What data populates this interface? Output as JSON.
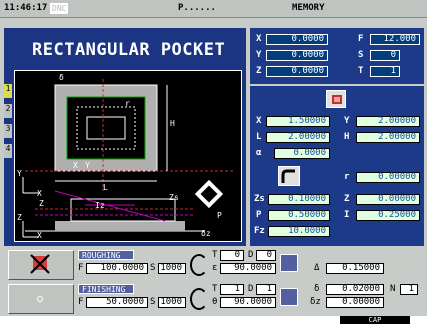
{
  "status": {
    "time": "11:46:17",
    "mode_badge": "DNC",
    "program": "P......",
    "memory": "MEMORY"
  },
  "title": "RECTANGULAR POCKET",
  "side_tabs": [
    "1",
    "2",
    "3",
    "4"
  ],
  "top_params": [
    {
      "label": "X",
      "value": "0.0000"
    },
    {
      "label": "F",
      "value": "12.000"
    },
    {
      "label": "Y",
      "value": "0.0000"
    },
    {
      "label": "S",
      "value": "0"
    },
    {
      "label": "Z",
      "value": "0.0000"
    },
    {
      "label": "T",
      "value": "1"
    }
  ],
  "geom_params": {
    "x_label": "X",
    "x_value": "1.50000",
    "y_label": "Y",
    "y_value": "2.00000",
    "l_label": "L",
    "l_value": "2.00000",
    "h_label": "H",
    "h_value": "2.00000",
    "a_label": "α",
    "a_value": "0.0000",
    "r_label": "r",
    "r_value": "0.00000",
    "zs_label": "Zs",
    "zs_value": "0.10000",
    "z_label": "Z",
    "z_value": "0.00000",
    "p_label": "P",
    "p_value": "0.50000",
    "i_label": "I",
    "i_value": "0.25000",
    "fz_label": "Fz",
    "fz_value": "10.0000"
  },
  "drawing_labels": {
    "d_top": "δ",
    "r": "r",
    "h": "H",
    "l": "L",
    "x": "X",
    "y": "Y",
    "zs": "Zs",
    "z": "Z",
    "iz": "Iz",
    "p": "P",
    "dz": "δz",
    "axis_y": "Y",
    "axis_x": "X",
    "axis_z": "Z",
    "axis_x2": "X"
  },
  "roughing": {
    "tag": "ROUGHING",
    "f_label": "F",
    "f_value": "100.0000",
    "s_label": "S",
    "s_value": "1000",
    "t_label": "T",
    "t_value": "0",
    "d_label": "D",
    "d_value": "0",
    "e_label": "ε",
    "e_value": "90.0000",
    "delta_label": "Δ",
    "delta_value": "0.15000"
  },
  "finishing": {
    "tag": "FINISHING",
    "f_label": "F",
    "f_value": "50.0000",
    "s_label": "S",
    "s_value": "1000",
    "t_label": "T",
    "t_value": "1",
    "d_label": "D",
    "d_value": "1",
    "theta_label": "θ",
    "theta_value": "90.0000",
    "delta_label": "δ",
    "delta_value": "0.02000",
    "n_label": "N",
    "n_value": "1",
    "dz_label": "δz",
    "dz_value": "0.00000"
  },
  "footer": {
    "cap": "CAP"
  },
  "colors": {
    "panel": "#1d3a8a",
    "field": "#003e7e",
    "green_field": "#dfffdf",
    "bg": "#c8ccc8"
  }
}
